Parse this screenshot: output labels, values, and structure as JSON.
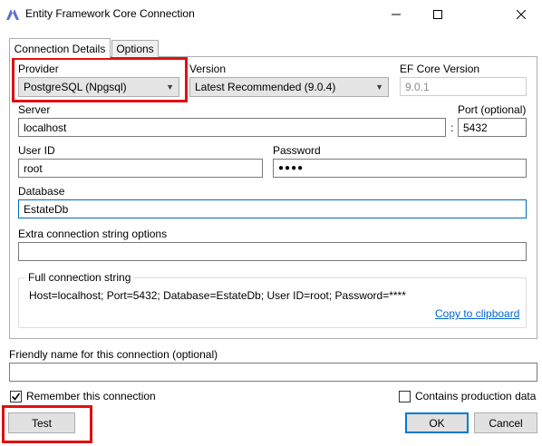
{
  "window": {
    "title": "Entity Framework Core Connection"
  },
  "tabs": [
    {
      "label": "Connection Details",
      "active": true
    },
    {
      "label": "Options",
      "active": false
    }
  ],
  "provider": {
    "label": "Provider",
    "value": "PostgreSQL (Npgsql)"
  },
  "version": {
    "label": "Version",
    "value": "Latest Recommended (9.0.4)"
  },
  "ef_core_version": {
    "label": "EF Core Version",
    "value": "9.0.1"
  },
  "server": {
    "label": "Server",
    "value": "localhost"
  },
  "port": {
    "label": "Port (optional)",
    "separator": ":",
    "value": "5432"
  },
  "user_id": {
    "label": "User ID",
    "value": "root"
  },
  "password": {
    "label": "Password",
    "value": "●●●●"
  },
  "database": {
    "label": "Database",
    "value": "EstateDb"
  },
  "extra_options": {
    "label": "Extra connection string options",
    "value": ""
  },
  "full_connection": {
    "label": "Full connection string",
    "value": "Host=localhost; Port=5432; Database=EstateDb; User ID=root; Password=****",
    "copy_link": "Copy to clipboard"
  },
  "friendly_name": {
    "label": "Friendly name for this connection (optional)",
    "value": ""
  },
  "remember": {
    "label": "Remember this connection",
    "checked": true
  },
  "production": {
    "label": "Contains production data",
    "checked": false
  },
  "buttons": {
    "test": "Test",
    "ok": "OK",
    "cancel": "Cancel"
  },
  "colors": {
    "highlight": "#e01010",
    "link": "#0066cc",
    "focus": "#0067c0",
    "app_icon": "#5b6fd6"
  }
}
